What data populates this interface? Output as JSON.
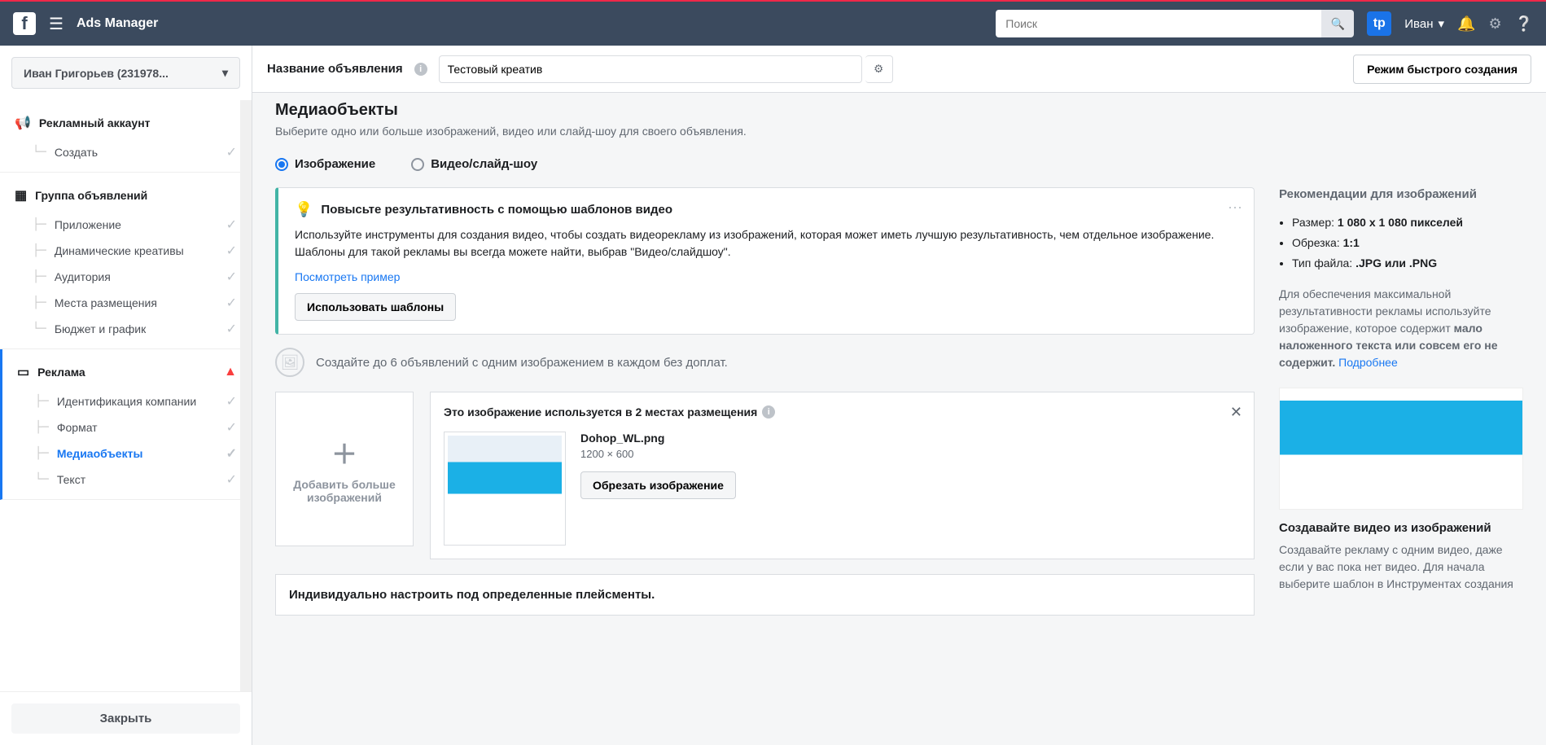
{
  "topbar": {
    "app_title": "Ads Manager",
    "search_placeholder": "Поиск",
    "user_name": "Иван"
  },
  "sidebar": {
    "account": "Иван Григорьев (231978...",
    "section1_title": "Рекламный аккаунт",
    "section1_item": "Создать",
    "section2_title": "Группа объявлений",
    "section2_items": [
      "Приложение",
      "Динамические креативы",
      "Аудитория",
      "Места размещения",
      "Бюджет и график"
    ],
    "section3_title": "Реклама",
    "section3_items": [
      "Идентификация компании",
      "Формат",
      "Медиаобъекты",
      "Текст"
    ],
    "close_btn": "Закрыть"
  },
  "header": {
    "label": "Название объявления",
    "value": "Тестовый креатив",
    "quick_btn": "Режим быстрого создания"
  },
  "media": {
    "title": "Медиаобъекты",
    "subtitle": "Выберите одно или больше изображений, видео или слайд-шоу для своего объявления.",
    "tab_image": "Изображение",
    "tab_video": "Видео/слайд-шоу",
    "tip_title": "Повысьте результативность с помощью шаблонов видео",
    "tip_text": "Используйте инструменты для создания видео, чтобы создать видеорекламу из изображений, которая может иметь лучшую результативность, чем отдельное изображение. Шаблоны для такой рекламы вы всегда можете найти, выбрав \"Видео/слайдшоу\".",
    "tip_link": "Посмотреть пример",
    "tip_btn": "Использовать шаблоны",
    "info_row": "Создайте до 6 объявлений с одним изображением в каждом без доплат.",
    "add_more": "Добавить больше изображений",
    "card_title": "Это изображение используется в 2 местах размещения",
    "file_name": "Dohop_WL.png",
    "file_dims": "1200 × 600",
    "crop_btn": "Обрезать изображение",
    "placement_title": "Индивидуально настроить под определенные плейсменты."
  },
  "rec": {
    "title": "Рекомендации для изображений",
    "size_label": "Размер:",
    "size_value": "1 080 x 1 080 пикселей",
    "crop_label": "Обрезка:",
    "crop_value": "1:1",
    "type_label": "Тип файла:",
    "type_value": ".JPG или .PNG",
    "note_pre": "Для обеспечения максимальной результативности рекламы используйте изображение, которое содержит ",
    "note_bold": "мало наложенного текста или совсем его не содержит.",
    "note_link": "Подробнее",
    "video_title": "Создавайте видео из изображений",
    "video_text": "Создавайте рекламу с одним видео, даже если у вас пока нет видео. Для начала выберите шаблон в Инструментах создания"
  }
}
